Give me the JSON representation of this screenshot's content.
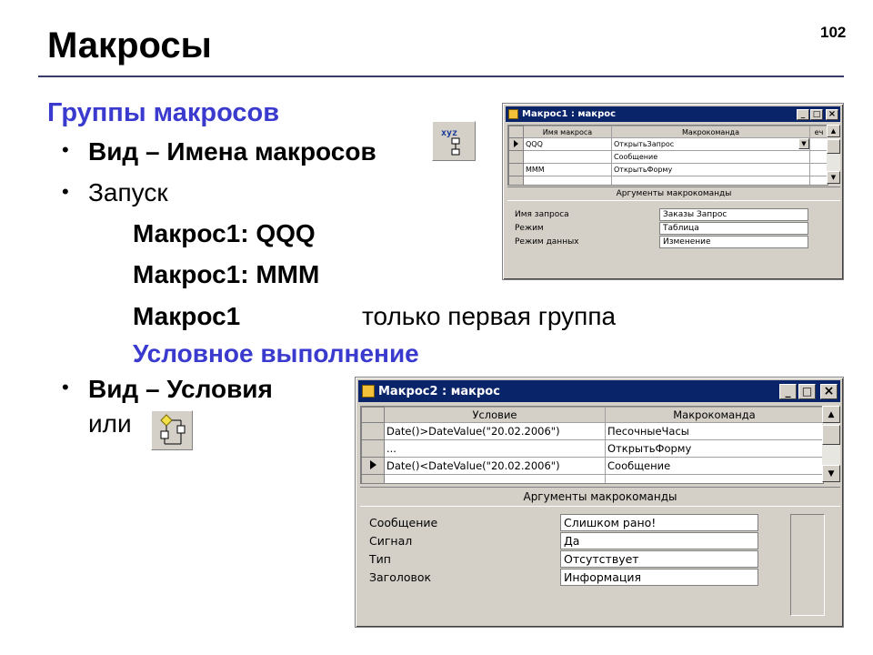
{
  "slide": {
    "title": "Макросы",
    "page_number": "102",
    "subtitle": "Группы макросов",
    "bullet1": "Вид – Имена макросов",
    "bullet2": "Запуск",
    "line1": "Макрос1: QQQ",
    "line2": "Макрос1: MMM",
    "line3a": "Макрос1",
    "line3b": "только первая группа",
    "conditional": "Условное выполнение",
    "bullet3": "Вид – Условия",
    "or_text": "или"
  },
  "icons": {
    "macro_names": "macro-names-icon",
    "conditions": "conditions-icon"
  },
  "window1": {
    "title": "Макрос1 : макрос",
    "col_name": "Имя макроса",
    "col_action": "Макрокоманда",
    "col_note": "еч",
    "rows": [
      {
        "name": "QQQ",
        "action": "ОткрытьЗапрос"
      },
      {
        "name": "",
        "action": "Сообщение"
      },
      {
        "name": "MMM",
        "action": "ОткрытьФорму"
      }
    ],
    "args_header": "Аргументы макрокоманды",
    "params": [
      {
        "label": "Имя запроса",
        "value": "Заказы Запрос"
      },
      {
        "label": "Режим",
        "value": "Таблица"
      },
      {
        "label": "Режим данных",
        "value": "Изменение"
      }
    ]
  },
  "window2": {
    "title": "Макрос2 : макрос",
    "col_condition": "Условие",
    "col_action": "Макрокоманда",
    "rows": [
      {
        "condition": "Date()>DateValue(\"20.02.2006\")",
        "action": "ПесочныеЧасы"
      },
      {
        "condition": "...",
        "action": "ОткрытьФорму"
      },
      {
        "condition": "Date()<DateValue(\"20.02.2006\")",
        "action": "Сообщение"
      }
    ],
    "args_header": "Аргументы макрокоманды",
    "params": [
      {
        "label": "Сообщение",
        "value": "Слишком рано!"
      },
      {
        "label": "Сигнал",
        "value": "Да"
      },
      {
        "label": "Тип",
        "value": "Отсутствует"
      },
      {
        "label": "Заголовок",
        "value": "Информация"
      }
    ]
  },
  "window_buttons": {
    "minimize": "_",
    "maximize": "□",
    "close": "×"
  },
  "colors": {
    "title_bar": "#0a246a",
    "heading_blue": "#3a3acf",
    "window_face": "#d4d0c8"
  }
}
